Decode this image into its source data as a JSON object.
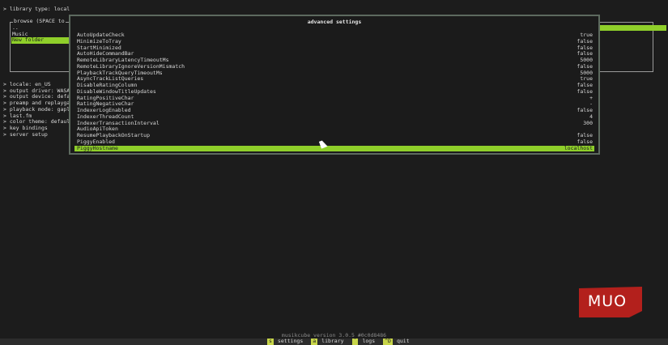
{
  "library_type_line": "> library type: local",
  "browse": {
    "title": "browse (SPACE to",
    "items": [
      {
        "label": ".."
      },
      {
        "label": "Music"
      },
      {
        "label": "New folder"
      }
    ]
  },
  "settings_lines": [
    "> locale: en_US",
    "> output driver: WASAP",
    "> output device: defau",
    "> preamp and replaygai",
    "> playback mode: gaple",
    "> last.fm",
    "> color theme: default",
    "> key bindings",
    "> server setup"
  ],
  "dialog": {
    "title": "advanced settings",
    "rows": [
      {
        "name": "AutoUpdateCheck",
        "value": "true"
      },
      {
        "name": "MinimizeToTray",
        "value": "false"
      },
      {
        "name": "StartMinimized",
        "value": "false"
      },
      {
        "name": "AutoHideCommandBar",
        "value": "false"
      },
      {
        "name": "RemoteLibraryLatencyTimeoutMs",
        "value": "5000"
      },
      {
        "name": "RemoteLibraryIgnoreVersionMismatch",
        "value": "false"
      },
      {
        "name": "PlaybackTrackQueryTimeoutMs",
        "value": "5000"
      },
      {
        "name": "AsyncTrackListQueries",
        "value": "true"
      },
      {
        "name": "DisableRatingColumn",
        "value": "false"
      },
      {
        "name": "DisableWindowTitleUpdates",
        "value": "false"
      },
      {
        "name": "RatingPositiveChar",
        "value": "+"
      },
      {
        "name": "RatingNegativeChar",
        "value": "-"
      },
      {
        "name": "IndexerLogEnabled",
        "value": "false"
      },
      {
        "name": "IndexerThreadCount",
        "value": "4"
      },
      {
        "name": "IndexerTransactionInterval",
        "value": "300"
      },
      {
        "name": "AudioApiToken",
        "value": ""
      },
      {
        "name": "ResumePlaybackOnStartup",
        "value": "false"
      },
      {
        "name": "PiggyEnabled",
        "value": "false"
      },
      {
        "name": "PiggyHostname",
        "value": "localhost"
      }
    ],
    "selected_index": 18
  },
  "logo": {
    "text": "MUO"
  },
  "version": "musikcube version 3.0.5 #0c0d8486",
  "shortcuts": [
    {
      "key": "s",
      "label": "settings"
    },
    {
      "key": "a",
      "label": "library"
    },
    {
      "key": "`",
      "label": "logs"
    },
    {
      "key": "^D",
      "label": "quit"
    }
  ],
  "colors": {
    "accent": "#8fcf2a",
    "shortcut_key": "#c8d64a",
    "background": "#1c1c1c"
  }
}
